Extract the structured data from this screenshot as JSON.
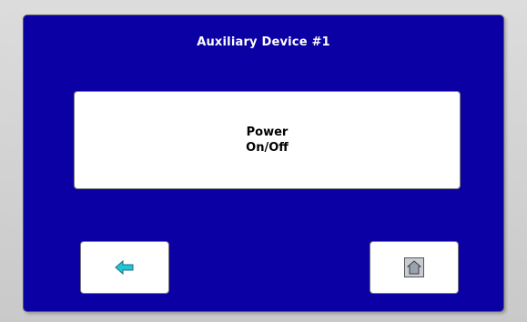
{
  "screen": {
    "title": "Auxiliary Device #1"
  },
  "power_button": {
    "line1": "Power",
    "line2": "On/Off"
  },
  "nav": {
    "back_icon": "back-arrow-icon",
    "home_icon": "home-icon"
  },
  "colors": {
    "panel_background": "#0a00a3",
    "button_background": "#ffffff",
    "back_arrow": "#22c5d6",
    "home_icon_fill": "#c8ccd2"
  }
}
